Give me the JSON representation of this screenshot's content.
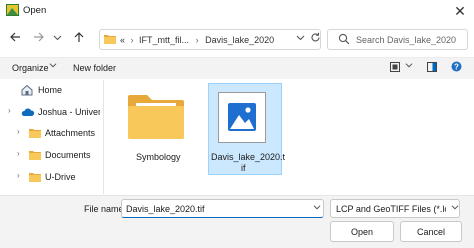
{
  "window": {
    "title": "Open",
    "close_glyph": "✕",
    "accent": "#0067c0"
  },
  "nav": {
    "back_icon": "arrow-left-icon",
    "forward_icon": "arrow-right-icon",
    "recent_icon": "chevron-down-icon",
    "up_icon": "arrow-up-icon"
  },
  "address": {
    "prefix": "«",
    "crumbs": [
      "IFT_mtt_fil...",
      "Davis_lake_2020"
    ],
    "separator": "›"
  },
  "search": {
    "placeholder": "Search Davis_lake_2020"
  },
  "toolbar": {
    "organize_label": "Organize",
    "new_folder_label": "New folder"
  },
  "sidebar": {
    "items": [
      {
        "label": "Home",
        "icon": "home-icon",
        "chevron": ""
      },
      {
        "label": "Joshua - Univers",
        "icon": "onedrive-cloud-icon",
        "chevron": "›"
      },
      {
        "label": "Attachments",
        "icon": "folder-icon",
        "chevron": "›"
      },
      {
        "label": "Documents",
        "icon": "folder-icon",
        "chevron": "›"
      },
      {
        "label": "U-Drive",
        "icon": "folder-icon",
        "chevron": "›"
      }
    ]
  },
  "files": [
    {
      "label": "Symbology",
      "type": "folder"
    },
    {
      "label_line1": "Davis_lake_2020.t",
      "label_line2": "if",
      "type": "image",
      "selected": true
    }
  ],
  "footer": {
    "file_name_label": "File name:",
    "file_name_value": "Davis_lake_2020.tif",
    "file_type_value": "LCP and GeoTIFF Files (*.lcp;*.tif",
    "open_label": "Open",
    "cancel_label": "Cancel"
  }
}
